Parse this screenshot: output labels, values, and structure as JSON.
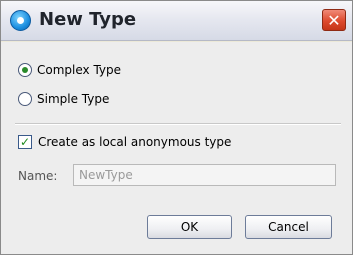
{
  "window": {
    "title": "New Type",
    "close_glyph": "✕"
  },
  "type_options": [
    {
      "label": "Complex Type",
      "selected": true
    },
    {
      "label": "Simple Type",
      "selected": false
    }
  ],
  "local_anonymous": {
    "label": "Create as local anonymous type",
    "checked": true,
    "check_glyph": "✓"
  },
  "name_field": {
    "label": "Name:",
    "value": "NewType"
  },
  "buttons": {
    "ok": "OK",
    "cancel": "Cancel"
  },
  "colors": {
    "accent_close": "#dd4a2e",
    "radio_dot": "#2a8a2a",
    "check_mark": "#1f8a1f"
  }
}
